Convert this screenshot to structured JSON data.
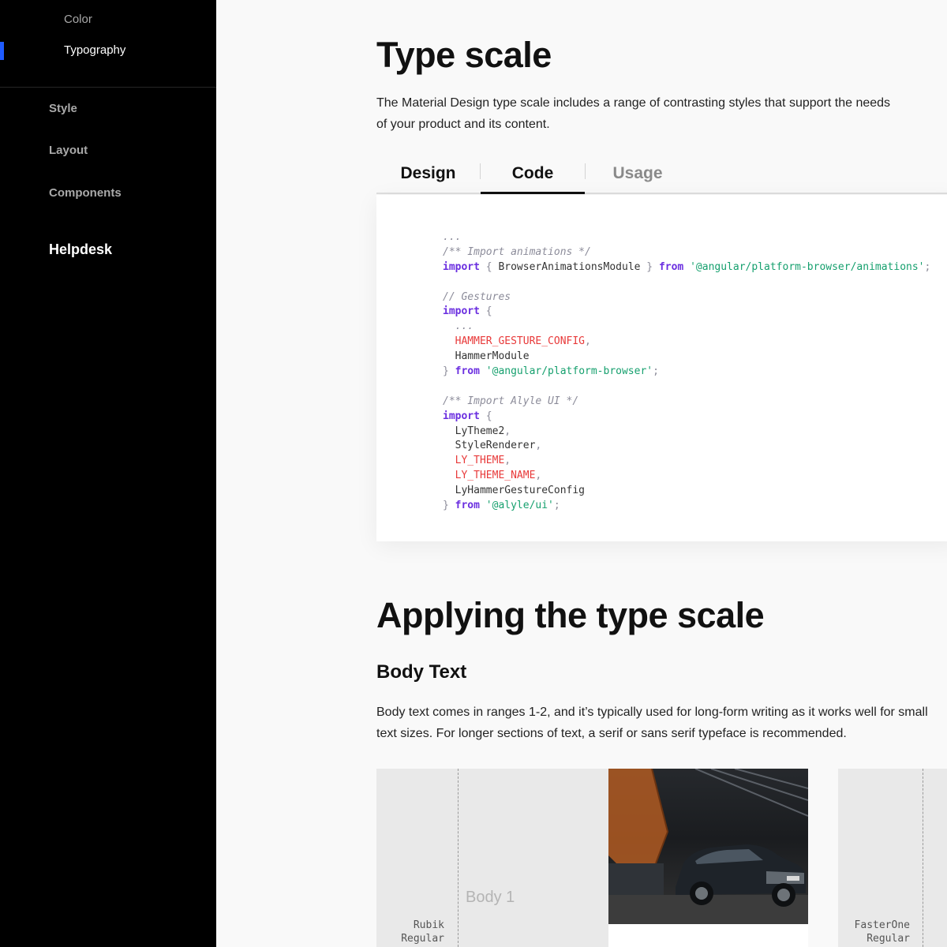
{
  "sidebar": {
    "sub_items": [
      {
        "label": "Color",
        "active": false
      },
      {
        "label": "Typography",
        "active": true
      }
    ],
    "nav_items": [
      {
        "label": "Style"
      },
      {
        "label": "Layout"
      },
      {
        "label": "Components"
      }
    ],
    "helpdesk": "Helpdesk",
    "accent": "#1f5bff"
  },
  "main": {
    "title": "Type scale",
    "intro": "The Material Design type scale includes a range of contrasting styles that support the needs of your product and its content.",
    "tabs": [
      {
        "label": "Design",
        "active": false
      },
      {
        "label": "Code",
        "active": true
      },
      {
        "label": "Usage",
        "active": false
      }
    ],
    "code_lines": [
      [
        {
          "t": "...",
          "c": "cm"
        }
      ],
      [
        {
          "t": "/** Import animations */",
          "c": "cm"
        }
      ],
      [
        {
          "t": "import",
          "c": "kw"
        },
        {
          "t": " { ",
          "c": "pun"
        },
        {
          "t": "BrowserAnimationsModule",
          "c": ""
        },
        {
          "t": " } ",
          "c": "pun"
        },
        {
          "t": "from",
          "c": "kw"
        },
        {
          "t": " '@angular/platform-browser/animations'",
          "c": "str"
        },
        {
          "t": ";",
          "c": "pun"
        }
      ],
      [],
      [
        {
          "t": "// Gestures",
          "c": "cm"
        }
      ],
      [
        {
          "t": "import",
          "c": "kw"
        },
        {
          "t": " {",
          "c": "pun"
        }
      ],
      [
        {
          "t": "  ...",
          "c": "cm"
        }
      ],
      [
        {
          "t": "  HAMMER_GESTURE_CONFIG",
          "c": "const"
        },
        {
          "t": ",",
          "c": "pun"
        }
      ],
      [
        {
          "t": "  HammerModule",
          "c": ""
        }
      ],
      [
        {
          "t": "} ",
          "c": "pun"
        },
        {
          "t": "from",
          "c": "kw"
        },
        {
          "t": " '@angular/platform-browser'",
          "c": "str"
        },
        {
          "t": ";",
          "c": "pun"
        }
      ],
      [],
      [
        {
          "t": "/** Import Alyle UI */",
          "c": "cm"
        }
      ],
      [
        {
          "t": "import",
          "c": "kw"
        },
        {
          "t": " {",
          "c": "pun"
        }
      ],
      [
        {
          "t": "  LyTheme2",
          "c": ""
        },
        {
          "t": ",",
          "c": "pun"
        }
      ],
      [
        {
          "t": "  StyleRenderer",
          "c": ""
        },
        {
          "t": ",",
          "c": "pun"
        }
      ],
      [
        {
          "t": "  LY_THEME",
          "c": "const"
        },
        {
          "t": ",",
          "c": "pun"
        }
      ],
      [
        {
          "t": "  LY_THEME_NAME",
          "c": "const"
        },
        {
          "t": ",",
          "c": "pun"
        }
      ],
      [
        {
          "t": "  LyHammerGestureConfig",
          "c": ""
        }
      ],
      [
        {
          "t": "} ",
          "c": "pun"
        },
        {
          "t": "from",
          "c": "kw"
        },
        {
          "t": " '@alyle/ui'",
          "c": "str"
        },
        {
          "t": ";",
          "c": "pun"
        }
      ]
    ],
    "applying_title": "Applying the type scale",
    "body_text_heading": "Body Text",
    "body_text_desc_1": "Body text comes in ranges 1-2, and it’s typically used for long-form writing as it works well for small",
    "body_text_desc_2": "text sizes. For longer sections of text, a serif or sans serif typeface is recommended.",
    "preview": {
      "left_font_line1": "Rubik",
      "left_font_line2": "Regular",
      "left_sample": "Body 1",
      "right_font_line1": "FasterOne",
      "right_font_line2": "Regular"
    }
  }
}
